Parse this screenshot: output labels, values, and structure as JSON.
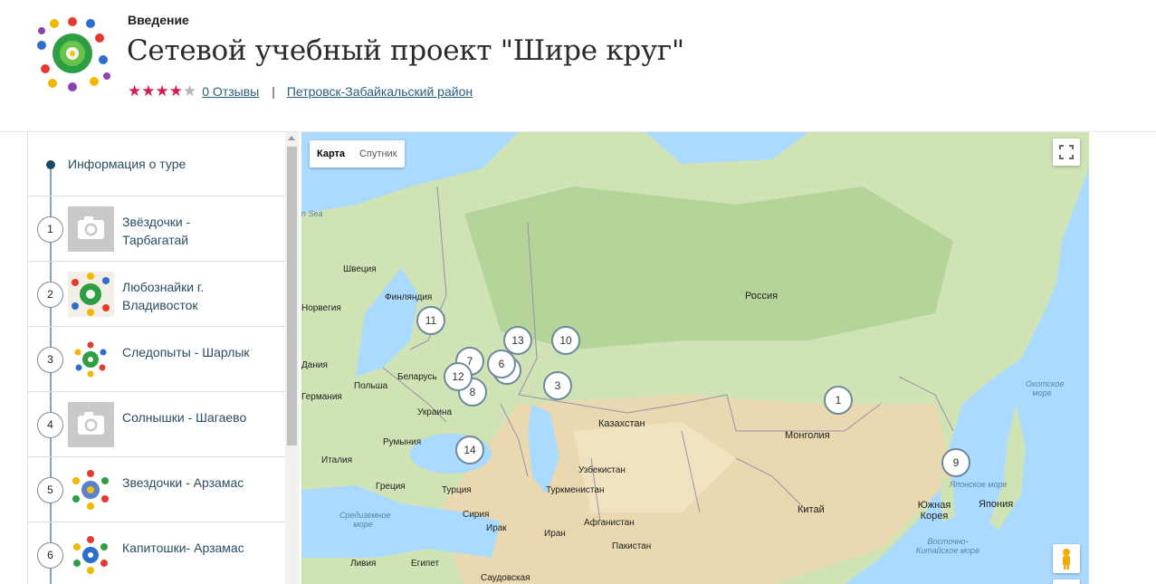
{
  "header": {
    "breadcrumb": "Введение",
    "title": "Сетевой учебный проект \"Шире круг\"",
    "rating": 4,
    "rating_max": 5,
    "reviews_link": "0 Отзывы",
    "separator": "|",
    "district_link": "Петровск-Забайкальский район",
    "accent_color": "#d31d54"
  },
  "sidebar": {
    "info_label": "Информация о туре",
    "items": [
      {
        "number": "1",
        "name": "Звёздочки - Тарбагатай",
        "thumb": "camera-placeholder"
      },
      {
        "number": "2",
        "name": "Любознайки г. Владивосток",
        "thumb": "children-circle-logo"
      },
      {
        "number": "3",
        "name": "Следопыты - Шарлык",
        "thumb": "children-circle-logo"
      },
      {
        "number": "4",
        "name": "Солнышки - Шагаево",
        "thumb": "camera-placeholder"
      },
      {
        "number": "5",
        "name": "Звездочки - Арзамас",
        "thumb": "children-circle-logo"
      },
      {
        "number": "6",
        "name": "Капитошки- Арзамас",
        "thumb": "children-circle-logo"
      }
    ]
  },
  "map": {
    "type_map": "Карта",
    "type_satellite": "Спутник",
    "labels": {
      "russia": "Россия",
      "kazakhstan": "Казахстан",
      "mongolia": "Монголия",
      "china": "Китай",
      "japan": "Япония",
      "south_korea": "Южная Корея",
      "sweden": "Швеция",
      "finland": "Финляндия",
      "norway": "Норвегия",
      "belarus": "Беларусь",
      "poland": "Польша",
      "germany": "Германия",
      "ukraine": "Украина",
      "romania": "Румыния",
      "italy": "Италия",
      "greece": "Греция",
      "turkey": "Турция",
      "uzbekistan": "Узбекистан",
      "turkmenistan": "Туркменистан",
      "afghanistan": "Афганистан",
      "pakistan": "Пакистан",
      "iran": "Иран",
      "iraq": "Ирак",
      "syria": "Сирия",
      "libya": "Ливия",
      "egypt": "Египет",
      "saudi": "Саудовская",
      "denmark": "Дания",
      "sea_okhotsk": "Охотское море",
      "sea_japan": "Японское море",
      "sea_ecs": "Восточно-Китайское море",
      "sea_med": "Средиземное море",
      "sea_north": "n Sea"
    },
    "markers": [
      "1",
      "3",
      "6",
      "7",
      "8",
      "9",
      "10",
      "11",
      "12",
      "13",
      "14"
    ]
  }
}
